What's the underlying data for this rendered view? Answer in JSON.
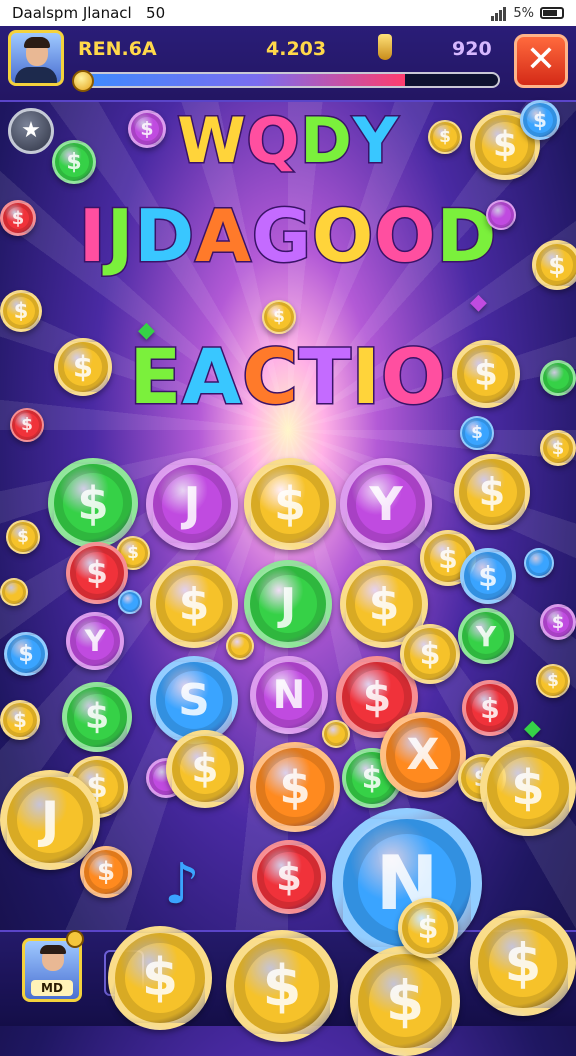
{
  "status_bar": {
    "left_text": "Daalspm Jlanacl",
    "time": "50",
    "battery_text": "5%"
  },
  "hud": {
    "player_label": "REN.6A",
    "score": "4.203",
    "coins": "920",
    "close_glyph": "✕",
    "progress_fraction": 0.78,
    "star_glyph": "★"
  },
  "titles": [
    "WQDY",
    "IJDAGOOD",
    "EACTIO"
  ],
  "title_colors": [
    "#ffd43a",
    "#ff4fa0",
    "#7bf03c",
    "#39c7ff",
    "#ff7a2a",
    "#c46bff"
  ],
  "bottom": {
    "mini_label": "MD"
  },
  "coins_colors": {
    "gold": "#f6c22a",
    "green": "#36d147",
    "purple": "#c04be0",
    "red": "#f0323a",
    "blue": "#3aa4ff",
    "orange": "#ff8a1f"
  }
}
